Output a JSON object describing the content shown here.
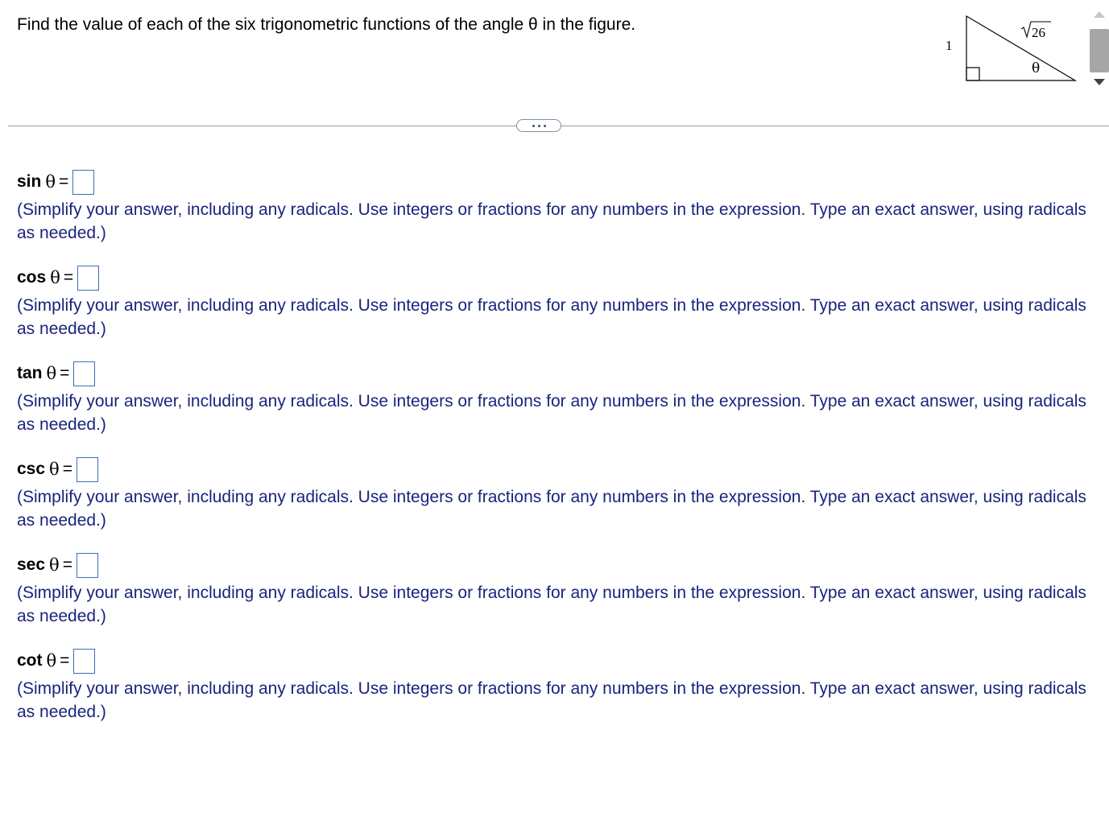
{
  "question": {
    "text": "Find the value of each of the six trigonometric functions of the angle θ in the figure."
  },
  "figure": {
    "side_label": "1",
    "hypotenuse_label": "26",
    "angle_label": "θ"
  },
  "more_button": {
    "label": "..."
  },
  "answers": [
    {
      "fn": "sin",
      "theta": "θ",
      "equals": "=",
      "value": "",
      "hint": "(Simplify your answer, including any radicals. Use integers or fractions for any numbers in the expression. Type an exact answer, using radicals as needed.)"
    },
    {
      "fn": "cos",
      "theta": "θ",
      "equals": "=",
      "value": "",
      "hint": "(Simplify your answer, including any radicals. Use integers or fractions for any numbers in the expression. Type an exact answer, using radicals as needed.)"
    },
    {
      "fn": "tan",
      "theta": "θ",
      "equals": "=",
      "value": "",
      "hint": "(Simplify your answer, including any radicals. Use integers or fractions for any numbers in the expression. Type an exact answer, using radicals as needed.)"
    },
    {
      "fn": "csc",
      "theta": "θ",
      "equals": "=",
      "value": "",
      "hint": "(Simplify your answer, including any radicals. Use integers or fractions for any numbers in the expression. Type an exact answer, using radicals as needed.)"
    },
    {
      "fn": "sec",
      "theta": "θ",
      "equals": "=",
      "value": "",
      "hint": "(Simplify your answer, including any radicals. Use integers or fractions for any numbers in the expression. Type an exact answer, using radicals as needed.)"
    },
    {
      "fn": "cot",
      "theta": "θ",
      "equals": "=",
      "value": "",
      "hint": "(Simplify your answer, including any radicals. Use integers or fractions for any numbers in the expression. Type an exact answer, using radicals as needed.)"
    }
  ],
  "colors": {
    "hint_text": "#1a237e",
    "answer_box_border": "#3e6eb4",
    "divider": "#9a9a9a"
  }
}
